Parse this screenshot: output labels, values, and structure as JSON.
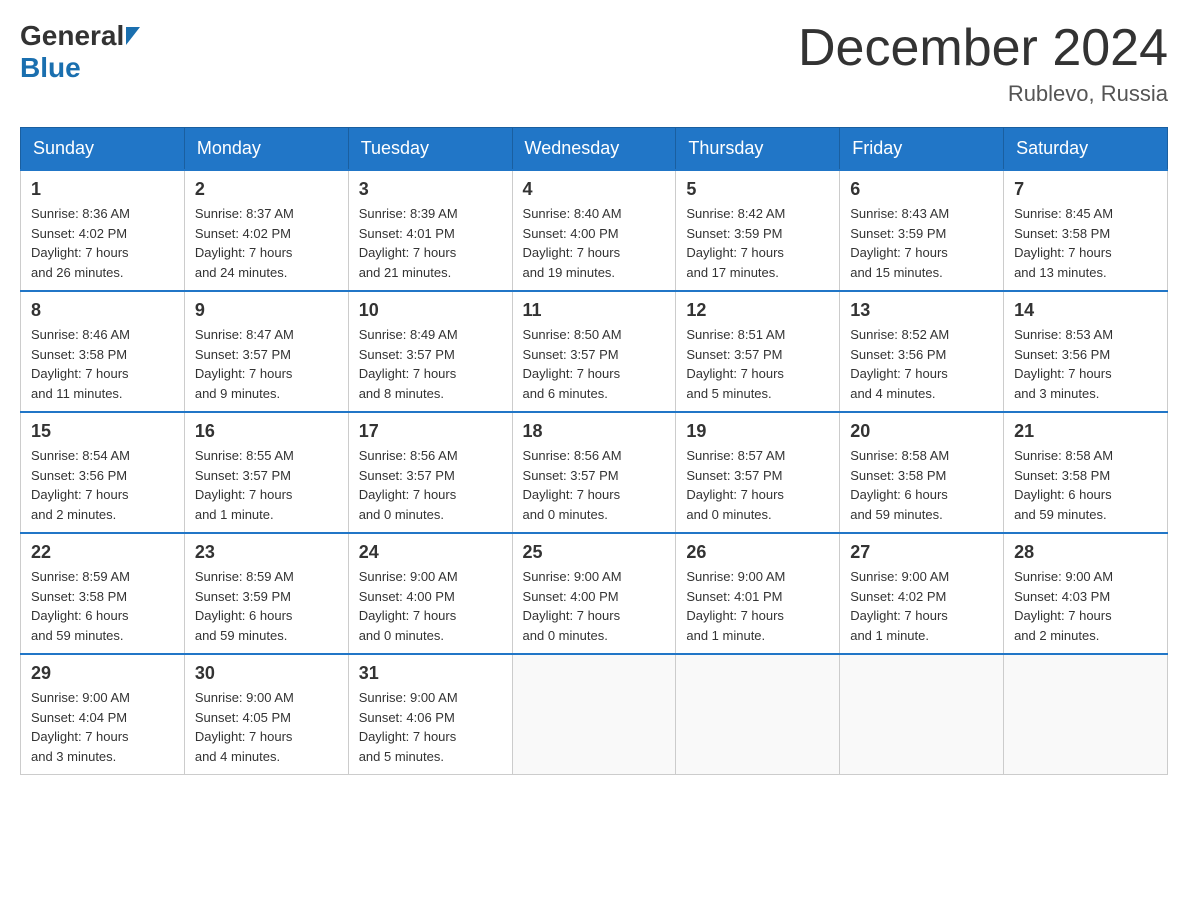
{
  "header": {
    "logo": {
      "general": "General",
      "blue": "Blue"
    },
    "title": "December 2024",
    "location": "Rublevo, Russia"
  },
  "weekdays": [
    "Sunday",
    "Monday",
    "Tuesday",
    "Wednesday",
    "Thursday",
    "Friday",
    "Saturday"
  ],
  "weeks": [
    [
      {
        "day": "1",
        "sunrise": "8:36 AM",
        "sunset": "4:02 PM",
        "daylight": "7 hours and 26 minutes."
      },
      {
        "day": "2",
        "sunrise": "8:37 AM",
        "sunset": "4:02 PM",
        "daylight": "7 hours and 24 minutes."
      },
      {
        "day": "3",
        "sunrise": "8:39 AM",
        "sunset": "4:01 PM",
        "daylight": "7 hours and 21 minutes."
      },
      {
        "day": "4",
        "sunrise": "8:40 AM",
        "sunset": "4:00 PM",
        "daylight": "7 hours and 19 minutes."
      },
      {
        "day": "5",
        "sunrise": "8:42 AM",
        "sunset": "3:59 PM",
        "daylight": "7 hours and 17 minutes."
      },
      {
        "day": "6",
        "sunrise": "8:43 AM",
        "sunset": "3:59 PM",
        "daylight": "7 hours and 15 minutes."
      },
      {
        "day": "7",
        "sunrise": "8:45 AM",
        "sunset": "3:58 PM",
        "daylight": "7 hours and 13 minutes."
      }
    ],
    [
      {
        "day": "8",
        "sunrise": "8:46 AM",
        "sunset": "3:58 PM",
        "daylight": "7 hours and 11 minutes."
      },
      {
        "day": "9",
        "sunrise": "8:47 AM",
        "sunset": "3:57 PM",
        "daylight": "7 hours and 9 minutes."
      },
      {
        "day": "10",
        "sunrise": "8:49 AM",
        "sunset": "3:57 PM",
        "daylight": "7 hours and 8 minutes."
      },
      {
        "day": "11",
        "sunrise": "8:50 AM",
        "sunset": "3:57 PM",
        "daylight": "7 hours and 6 minutes."
      },
      {
        "day": "12",
        "sunrise": "8:51 AM",
        "sunset": "3:57 PM",
        "daylight": "7 hours and 5 minutes."
      },
      {
        "day": "13",
        "sunrise": "8:52 AM",
        "sunset": "3:56 PM",
        "daylight": "7 hours and 4 minutes."
      },
      {
        "day": "14",
        "sunrise": "8:53 AM",
        "sunset": "3:56 PM",
        "daylight": "7 hours and 3 minutes."
      }
    ],
    [
      {
        "day": "15",
        "sunrise": "8:54 AM",
        "sunset": "3:56 PM",
        "daylight": "7 hours and 2 minutes."
      },
      {
        "day": "16",
        "sunrise": "8:55 AM",
        "sunset": "3:57 PM",
        "daylight": "7 hours and 1 minute."
      },
      {
        "day": "17",
        "sunrise": "8:56 AM",
        "sunset": "3:57 PM",
        "daylight": "7 hours and 0 minutes."
      },
      {
        "day": "18",
        "sunrise": "8:56 AM",
        "sunset": "3:57 PM",
        "daylight": "7 hours and 0 minutes."
      },
      {
        "day": "19",
        "sunrise": "8:57 AM",
        "sunset": "3:57 PM",
        "daylight": "7 hours and 0 minutes."
      },
      {
        "day": "20",
        "sunrise": "8:58 AM",
        "sunset": "3:58 PM",
        "daylight": "6 hours and 59 minutes."
      },
      {
        "day": "21",
        "sunrise": "8:58 AM",
        "sunset": "3:58 PM",
        "daylight": "6 hours and 59 minutes."
      }
    ],
    [
      {
        "day": "22",
        "sunrise": "8:59 AM",
        "sunset": "3:58 PM",
        "daylight": "6 hours and 59 minutes."
      },
      {
        "day": "23",
        "sunrise": "8:59 AM",
        "sunset": "3:59 PM",
        "daylight": "6 hours and 59 minutes."
      },
      {
        "day": "24",
        "sunrise": "9:00 AM",
        "sunset": "4:00 PM",
        "daylight": "7 hours and 0 minutes."
      },
      {
        "day": "25",
        "sunrise": "9:00 AM",
        "sunset": "4:00 PM",
        "daylight": "7 hours and 0 minutes."
      },
      {
        "day": "26",
        "sunrise": "9:00 AM",
        "sunset": "4:01 PM",
        "daylight": "7 hours and 1 minute."
      },
      {
        "day": "27",
        "sunrise": "9:00 AM",
        "sunset": "4:02 PM",
        "daylight": "7 hours and 1 minute."
      },
      {
        "day": "28",
        "sunrise": "9:00 AM",
        "sunset": "4:03 PM",
        "daylight": "7 hours and 2 minutes."
      }
    ],
    [
      {
        "day": "29",
        "sunrise": "9:00 AM",
        "sunset": "4:04 PM",
        "daylight": "7 hours and 3 minutes."
      },
      {
        "day": "30",
        "sunrise": "9:00 AM",
        "sunset": "4:05 PM",
        "daylight": "7 hours and 4 minutes."
      },
      {
        "day": "31",
        "sunrise": "9:00 AM",
        "sunset": "4:06 PM",
        "daylight": "7 hours and 5 minutes."
      },
      null,
      null,
      null,
      null
    ]
  ],
  "labels": {
    "sunrise": "Sunrise:",
    "sunset": "Sunset:",
    "daylight": "Daylight:"
  }
}
